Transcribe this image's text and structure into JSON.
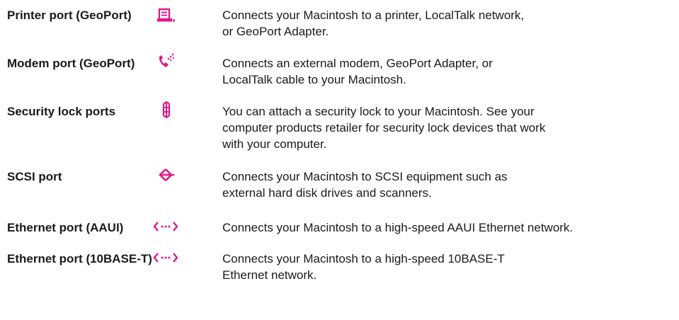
{
  "ports": [
    {
      "label": "Printer port (GeoPort)",
      "icon": "printer-icon",
      "description": "Connects your Macintosh to a printer, LocalTalk network,\nor GeoPort Adapter."
    },
    {
      "label": "Modem port (GeoPort)",
      "icon": "telephone-handset-icon",
      "description": "Connects an external modem, GeoPort Adapter, or\nLocalTalk cable to your Macintosh."
    },
    {
      "label": "Security lock ports",
      "icon": "security-lock-icon",
      "description": "You can attach a security lock to your Macintosh. See your\ncomputer products retailer for security lock devices that work\nwith your computer."
    },
    {
      "label": "SCSI port",
      "icon": "scsi-icon",
      "description": "Connects your Macintosh to SCSI equipment such as\nexternal hard disk drives and scanners."
    },
    {
      "label": "Ethernet port (AAUI)",
      "icon": "ethernet-icon",
      "description": "Connects your Macintosh to a high-speed AAUI Ethernet network."
    },
    {
      "label": "Ethernet port (10BASE-T)",
      "icon": "ethernet-icon",
      "description": "Connects your Macintosh to a high-speed 10BASE-T\nEthernet network."
    }
  ],
  "colors": {
    "icon_accent": "#e0198a",
    "text": "#1a1a1a"
  }
}
